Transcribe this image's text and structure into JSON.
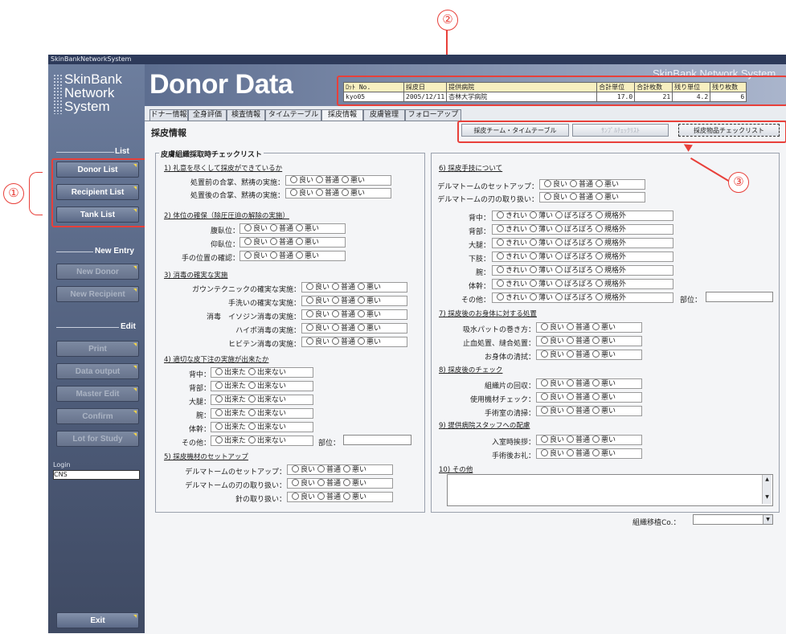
{
  "callouts": {
    "one": "①",
    "two": "②",
    "three": "③"
  },
  "window": {
    "title": "SkinBankNetworkSystem"
  },
  "logo": {
    "line1": "SkinBank",
    "line2": "Network",
    "line3": "System"
  },
  "header": {
    "title": "Donor Data",
    "brand": "SkinBank Network System"
  },
  "info": {
    "headers": [
      "ﾛｯﾄ No.",
      "採皮日",
      "提供病院",
      "合計単位",
      "合計枚数",
      "残り単位",
      "残り枚数"
    ],
    "values": [
      "kyo05",
      "2005/12/11",
      "杏林大学病院",
      "17.0",
      "21",
      "4.2",
      "6"
    ]
  },
  "sidebar": {
    "list_label": "List",
    "list": [
      "Donor List",
      "Recipient List",
      "Tank List"
    ],
    "new_label": "New Entry",
    "new": [
      "New Donor",
      "New Recipient"
    ],
    "edit_label": "Edit",
    "edit": [
      "Print",
      "Data output",
      "Master Edit",
      "Confirm",
      "Lot for Study"
    ],
    "login_label": "Login",
    "login_value": "CNS",
    "exit": "Exit"
  },
  "tabs": [
    "ドナー情報",
    "全身評価",
    "検査情報",
    "タイムテーブル",
    "採皮情報",
    "皮膚管理",
    "フォローアップ"
  ],
  "page": {
    "title": "採皮情報"
  },
  "buttons": {
    "team": "採皮チーム・タイムテーブル",
    "check": "ｻﾝﾌﾟﾙﾁｪｯｸﾘｽﾄ",
    "goods": "採皮物品チェックリスト"
  },
  "left": {
    "title": "皮膚組織採取時チェックリスト",
    "s1": "1) 礼意を尽くして採皮ができているか",
    "s1r": [
      "処置前の合掌、黙祷の実施：",
      "処置後の合掌、黙祷の実施："
    ],
    "s2": "2) 体位の確保（除圧圧迫の解除の実施）",
    "s2r": [
      "腹臥位：",
      "仰臥位：",
      "手の位置の確認："
    ],
    "s3": "3) 消毒の確実な実施",
    "s3r": [
      "ガウンテクニックの確実な実施：",
      "手洗いの確実な実施：",
      "消毒　イソジン消毒の実施：",
      "ハイポ消毒の実施：",
      "ヒビテン消毒の実施："
    ],
    "s4": "4) 適切な皮下注の実施が出来たか",
    "s4r": [
      "背中：",
      "背部：",
      "大腿：",
      "腕：",
      "体幹：",
      "その他："
    ],
    "site": "部位：",
    "s5": "5) 採皮機材のセットアップ",
    "s5r": [
      "デルマトームのセットアップ：",
      "デルマトームの刃の取り扱い：",
      "針の取り扱い："
    ]
  },
  "right": {
    "s6": "6) 採皮手技について",
    "s6a": [
      "デルマトームのセットアップ：",
      "デルマトームの刃の取り扱い："
    ],
    "s6b": [
      "背中：",
      "背部：",
      "大腿：",
      "下肢：",
      "腕：",
      "体幹：",
      "その他："
    ],
    "site": "部位：",
    "s7": "7) 採皮後のお身体に対する処置",
    "s7r": [
      "吸水パットの巻き方：",
      "止血処置、縫合処置：",
      "お身体の清拭："
    ],
    "s8": "8) 採皮後のチェック",
    "s8r": [
      "組織片の回収：",
      "使用機材チェック：",
      "手術室の清掃："
    ],
    "s9": "9) 提供病院スタッフへの配慮",
    "s9r": [
      "入室時挨拶：",
      "手術後お礼："
    ],
    "s10": "10) その他"
  },
  "opt": {
    "good": "良い",
    "normal": "普通",
    "bad": "悪い",
    "done": "出来た",
    "notdone": "出来ない",
    "clean": "きれい",
    "thin": "薄い",
    "rough": "ぼろぼろ",
    "out": "規格外"
  },
  "transfer": {
    "label": "組織移植Co.：",
    "value": ""
  }
}
